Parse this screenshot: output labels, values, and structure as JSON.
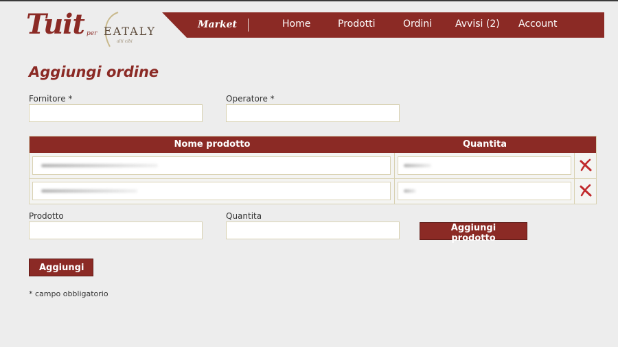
{
  "brand": {
    "logo_main": "Tuit",
    "logo_per": "per",
    "logo_partner": "EATALY",
    "logo_tagline": "alti cibi"
  },
  "nav": {
    "brand": "Market",
    "items": [
      "Home",
      "Prodotti",
      "Ordini",
      "Avvisi (2)",
      "Account"
    ]
  },
  "page": {
    "title": "Aggiungi ordine"
  },
  "form": {
    "fornitore_label": "Fornitore *",
    "operatore_label": "Operatore *",
    "prodotto_label": "Prodotto",
    "quantita_label": "Quantita",
    "add_product_button": "Aggiungi prodotto",
    "submit_button": "Aggiungi",
    "required_note": "* campo obbligatorio"
  },
  "table": {
    "columns": [
      "Nome prodotto",
      "Quantita"
    ]
  },
  "colors": {
    "accent": "#8b2a25",
    "background": "#ededed",
    "border": "#d9d2b3",
    "delete_icon": "#c0282b"
  },
  "icons": {
    "delete": "close-x-icon"
  }
}
